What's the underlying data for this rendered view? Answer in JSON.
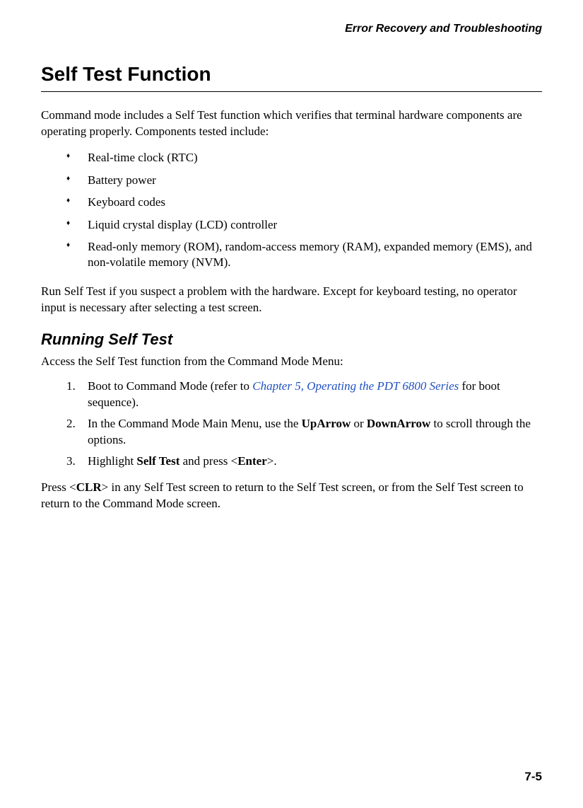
{
  "header": {
    "running_title": "Error Recovery and Troubleshooting"
  },
  "section": {
    "heading": "Self Test Function",
    "intro": "Command mode includes a Self Test function which verifies that terminal hardware components are operating properly. Components tested include:",
    "bullets": [
      "Real-time clock (RTC)",
      "Battery power",
      "Keyboard codes",
      "Liquid crystal display (LCD) controller",
      "Read-only memory (ROM), random-access memory (RAM), expanded memory (EMS), and non-volatile memory (NVM)."
    ],
    "after_bullets": "Run Self Test if you suspect a problem with the hardware. Except for keyboard testing, no operator input is necessary after selecting a test screen."
  },
  "subsection": {
    "heading": "Running Self Test",
    "intro": "Access the Self Test function from the Command Mode Menu:",
    "steps": {
      "step1_pre": "Boot to Command Mode (refer to ",
      "step1_link": "Chapter 5, Operating the PDT 6800 Series",
      "step1_post": " for boot sequence).",
      "step2_pre": "In the Command Mode Main Menu, use the ",
      "step2_up": "UpArrow",
      "step2_mid": " or ",
      "step2_down": "DownArrow",
      "step2_post": " to scroll through the options.",
      "step3_pre": "Highlight ",
      "step3_selftest": "Self Test",
      "step3_mid": " and press <",
      "step3_enter": "Enter",
      "step3_post": ">."
    },
    "closing_pre": "Press <",
    "closing_clr": "CLR",
    "closing_post": "> in any Self Test screen to return to the Self Test screen, or from the Self Test screen to return to the Command Mode screen."
  },
  "footer": {
    "page_number": "7-5"
  }
}
